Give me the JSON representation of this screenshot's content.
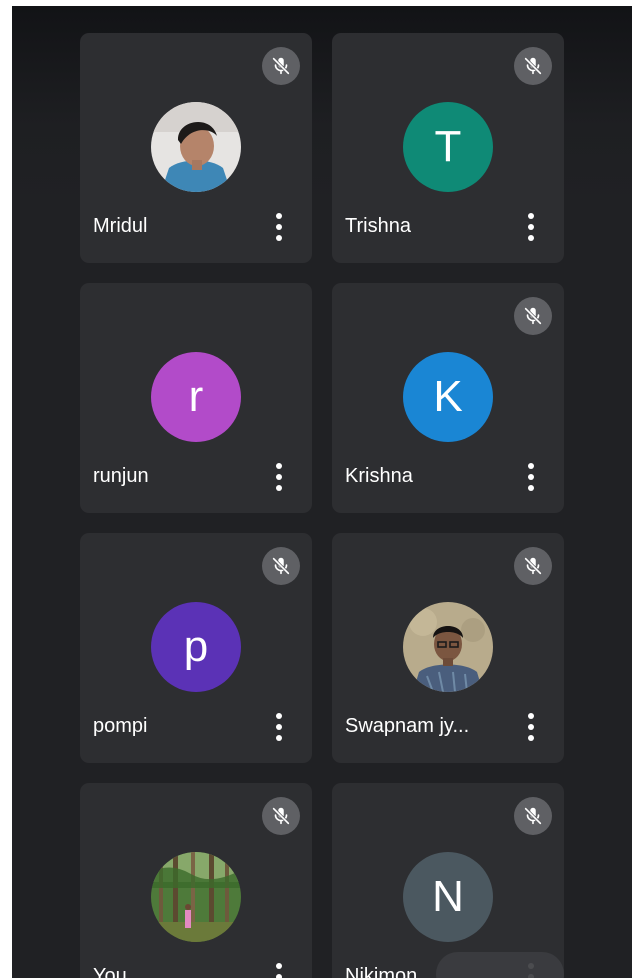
{
  "participants": [
    {
      "name": "Mridul",
      "avatar_type": "photo",
      "photo_desc": "boy-portrait",
      "muted": true
    },
    {
      "name": "Trishna",
      "initial": "T",
      "avatar_color": "#0f8a76",
      "muted": true
    },
    {
      "name": "runjun",
      "initial": "r",
      "avatar_color": "#b24bc9",
      "muted": false
    },
    {
      "name": "Krishna",
      "initial": "K",
      "avatar_color": "#1a86d4",
      "muted": true
    },
    {
      "name": "pompi",
      "initial": "p",
      "avatar_color": "#5b32b6",
      "muted": true
    },
    {
      "name": "Swapnam jy...",
      "avatar_type": "photo",
      "photo_desc": "man-portrait",
      "muted": true
    },
    {
      "name": "You",
      "avatar_type": "photo",
      "photo_desc": "forest-photo",
      "muted": true
    },
    {
      "name": "Nikimon",
      "initial": "N",
      "avatar_color": "#4b5860",
      "muted": true
    }
  ],
  "icons": {
    "mute": "mic-off-icon",
    "more": "more-vert-icon"
  },
  "colors": {
    "tile_bg": "#2d2e31",
    "mute_badge": "#5f6064",
    "background": "#202124"
  }
}
